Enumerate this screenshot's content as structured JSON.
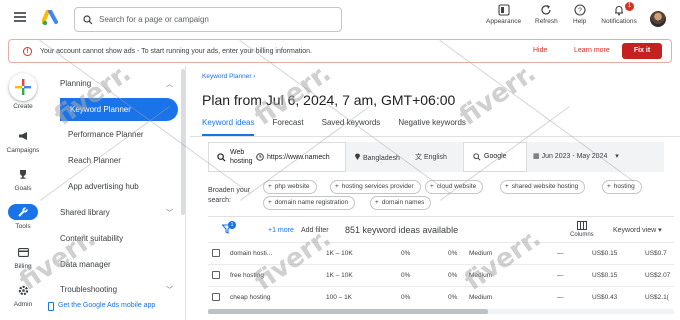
{
  "topbar": {
    "search_placeholder": "Search for a page or campaign",
    "actions": [
      {
        "label": "Appearance",
        "icon": "appearance-icon"
      },
      {
        "label": "Refresh",
        "icon": "refresh-icon"
      },
      {
        "label": "Help",
        "icon": "help-icon"
      },
      {
        "label": "Notifications",
        "icon": "bell-icon",
        "badge": "1"
      }
    ]
  },
  "alert": {
    "message": "Your account cannot show ads - To start running your ads, enter your billing information.",
    "hide": "Hide",
    "learn_more": "Learn more",
    "fix": "Fix it"
  },
  "rail": {
    "create": "Create",
    "campaigns": "Campaigns",
    "goals": "Goals",
    "tools": "Tools",
    "billing": "Billing",
    "admin": "Admin"
  },
  "menu": {
    "planning": "Planning",
    "keyword_planner": "Keyword Planner",
    "performance_planner": "Performance Planner",
    "reach_planner": "Reach Planner",
    "app_advertising_hub": "App advertising hub",
    "shared_library": "Shared library",
    "content_suitability": "Content suitability",
    "data_manager": "Data manager",
    "troubleshooting": "Troubleshooting",
    "mobile_app": "Get the Google Ads mobile app"
  },
  "main": {
    "breadcrumb": "Keyword Planner ›",
    "title": "Plan from Jul 6, 2024, 7 am, GMT+06:00",
    "tabs": [
      "Keyword ideas",
      "Forecast",
      "Saved keywords",
      "Negative keywords"
    ],
    "seed_label": "Web hosting",
    "seed_url": "https://www.namech",
    "location": "Bangladesh",
    "language": "English",
    "network": "Google",
    "date_range": "Jun 2023 - May 2024",
    "broaden_label": "Broaden your search:",
    "chips": [
      "php website",
      "hosting services provider",
      "cloud website",
      "shared website hosting",
      "hosting",
      "domain name registration",
      "domain names"
    ],
    "filter_badge": "1",
    "more_filters": "+1 more",
    "add_filter": "Add filter",
    "count": "851 keyword ideas available",
    "columns": "Columns",
    "keyword_view": "Keyword view"
  },
  "rows": [
    {
      "keyword": "domain hosti...",
      "searches": "1K – 10K",
      "change3m": "0%",
      "yoy": "0%",
      "competition": "Medium",
      "index": "—",
      "bid_low": "US$0.15",
      "bid_high": "US$0.7"
    },
    {
      "keyword": "free hosting",
      "searches": "1K – 10K",
      "change3m": "0%",
      "yoy": "0%",
      "competition": "Medium",
      "index": "—",
      "bid_low": "US$0.15",
      "bid_high": "US$2.07"
    },
    {
      "keyword": "cheap hosting",
      "searches": "100 – 1K",
      "change3m": "0%",
      "yoy": "0%",
      "competition": "Medium",
      "index": "—",
      "bid_low": "US$0.43",
      "bid_high": "US$2.1("
    }
  ],
  "watermark": "fiverr."
}
